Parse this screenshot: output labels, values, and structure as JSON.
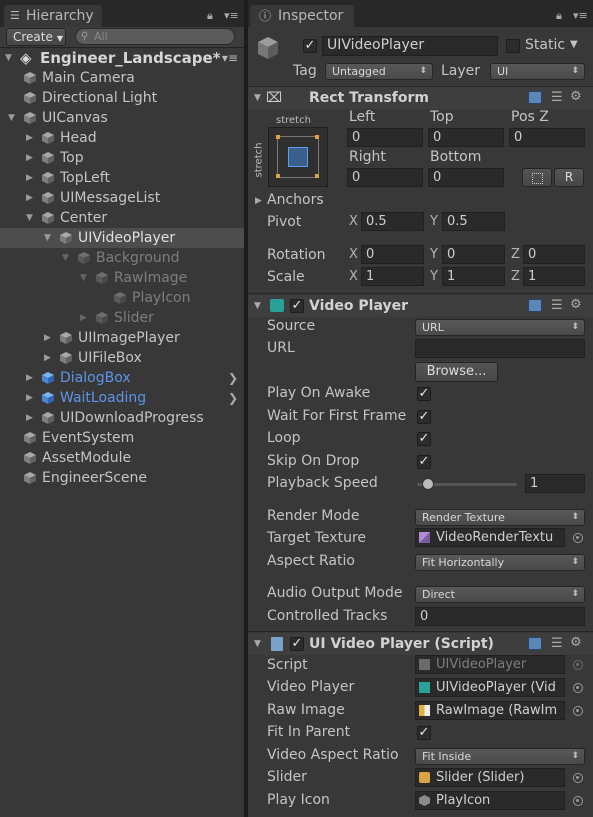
{
  "hierarchy": {
    "tab_title": "Hierarchy",
    "create_label": "Create",
    "search_placeholder": "All",
    "scene": "Engineer_Landscape*",
    "items": [
      {
        "label": "Main Camera"
      },
      {
        "label": "Directional Light"
      },
      {
        "label": "UICanvas"
      },
      {
        "label": "Head"
      },
      {
        "label": "Top"
      },
      {
        "label": "TopLeft"
      },
      {
        "label": "UIMessageList"
      },
      {
        "label": "Center"
      },
      {
        "label": "UIVideoPlayer"
      },
      {
        "label": "Background"
      },
      {
        "label": "RawImage"
      },
      {
        "label": "PlayIcon"
      },
      {
        "label": "Slider"
      },
      {
        "label": "UIImagePlayer"
      },
      {
        "label": "UIFileBox"
      },
      {
        "label": "DialogBox"
      },
      {
        "label": "WaitLoading"
      },
      {
        "label": "UIDownloadProgress"
      },
      {
        "label": "EventSystem"
      },
      {
        "label": "AssetModule"
      },
      {
        "label": "EngineerScene"
      }
    ]
  },
  "inspector": {
    "tab_title": "Inspector",
    "object_name": "UIVideoPlayer",
    "static_label": "Static",
    "tag_label": "Tag",
    "tag_value": "Untagged",
    "layer_label": "Layer",
    "layer_value": "UI",
    "rect_transform": {
      "title": "Rect Transform",
      "stretch_top": "stretch",
      "stretch_side": "stretch",
      "left_label": "Left",
      "top_label": "Top",
      "posz_label": "Pos Z",
      "left": "0",
      "top": "0",
      "posz": "0",
      "right_label": "Right",
      "bottom_label": "Bottom",
      "right": "0",
      "bottom": "0",
      "raw_button": "R",
      "anchors_label": "Anchors",
      "pivot_label": "Pivot",
      "pivot_x": "0.5",
      "pivot_y": "0.5",
      "rotation_label": "Rotation",
      "rot_x": "0",
      "rot_y": "0",
      "rot_z": "0",
      "scale_label": "Scale",
      "scale_x": "1",
      "scale_y": "1",
      "scale_z": "1",
      "x": "X",
      "y": "Y",
      "z": "Z"
    },
    "video_player": {
      "title": "Video Player",
      "source_label": "Source",
      "source_value": "URL",
      "url_label": "URL",
      "url_value": "",
      "browse_label": "Browse...",
      "play_on_awake_label": "Play On Awake",
      "wait_first_frame_label": "Wait For First Frame",
      "loop_label": "Loop",
      "skip_on_drop_label": "Skip On Drop",
      "playback_speed_label": "Playback Speed",
      "playback_speed_value": "1",
      "render_mode_label": "Render Mode",
      "render_mode_value": "Render Texture",
      "target_texture_label": "Target Texture",
      "target_texture_value": "VideoRenderTextu",
      "aspect_ratio_label": "Aspect Ratio",
      "aspect_ratio_value": "Fit Horizontally",
      "audio_output_label": "Audio Output Mode",
      "audio_output_value": "Direct",
      "controlled_tracks_label": "Controlled Tracks",
      "controlled_tracks_value": "0"
    },
    "script": {
      "title": "UI Video Player (Script)",
      "script_label": "Script",
      "script_value": "UIVideoPlayer",
      "video_player_label": "Video Player",
      "video_player_value": "UIVideoPlayer (Vid",
      "raw_image_label": "Raw Image",
      "raw_image_value": "RawImage (RawIm",
      "fit_in_parent_label": "Fit In Parent",
      "video_aspect_label": "Video Aspect Ratio",
      "video_aspect_value": "Fit Inside",
      "slider_label": "Slider",
      "slider_value": "Slider (Slider)",
      "play_icon_label": "Play Icon",
      "play_icon_value": "PlayIcon"
    }
  }
}
